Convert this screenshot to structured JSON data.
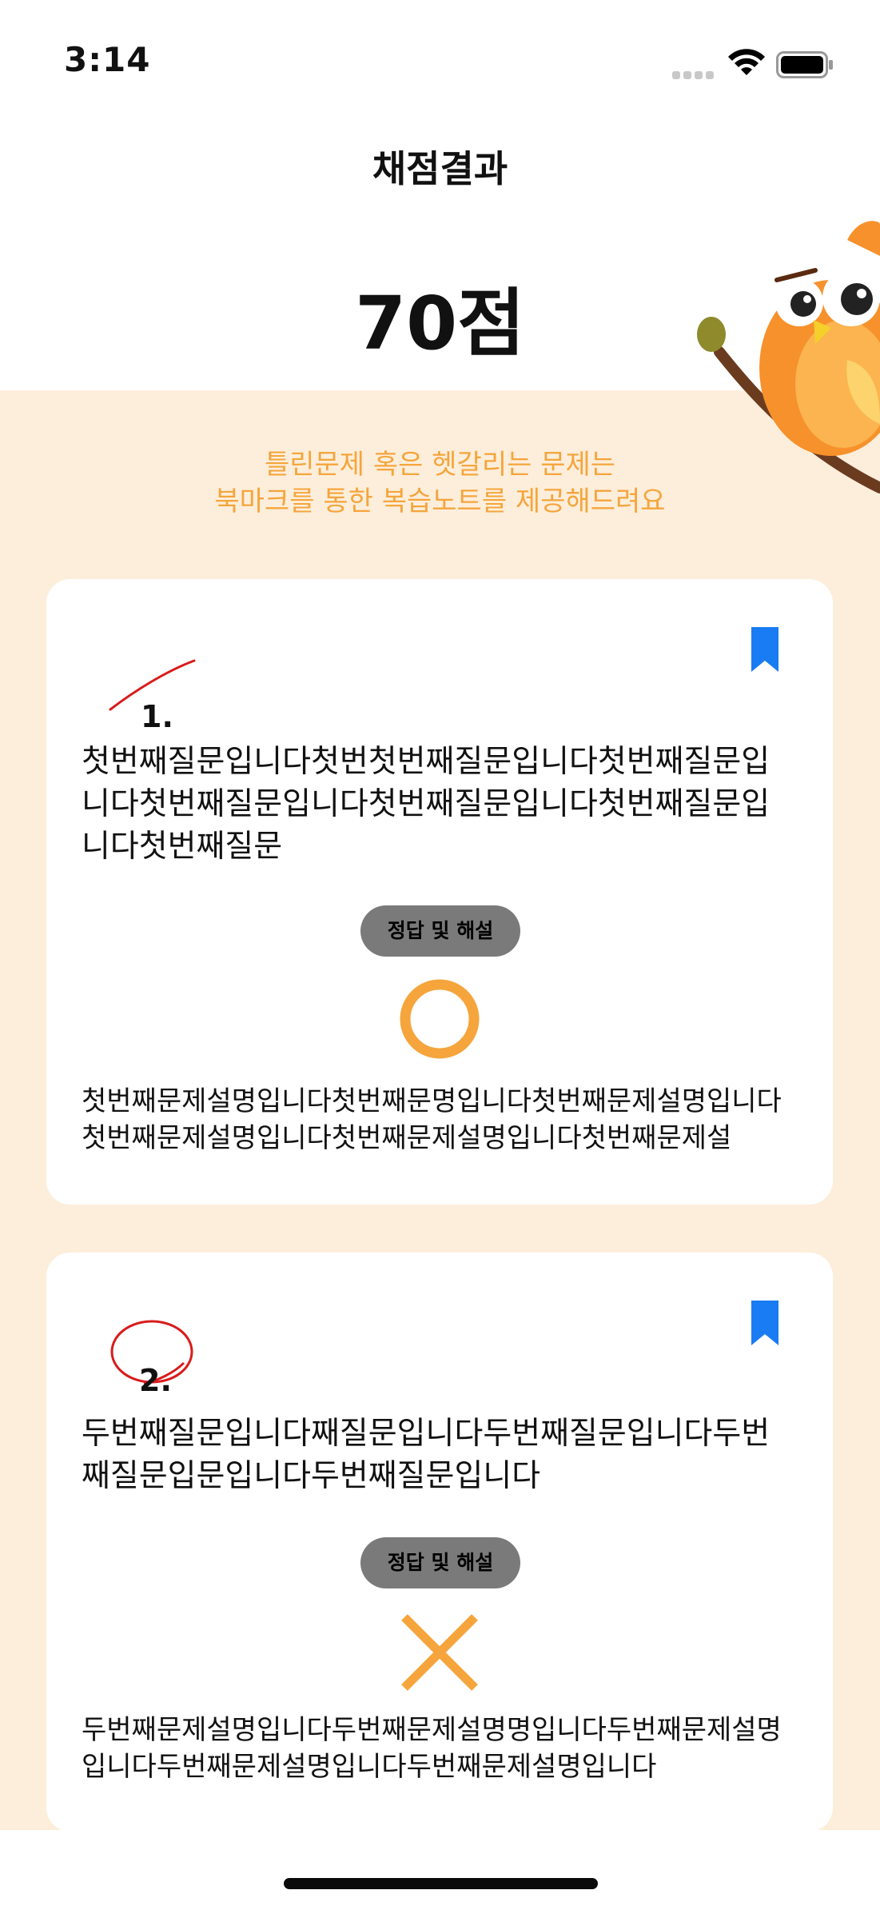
{
  "status_bar": {
    "time": "3:14"
  },
  "header": {
    "title": "채점결과",
    "score": "70점"
  },
  "notice": {
    "line1": "틀린문제 혹은 헷갈리는 문제는",
    "line2": "북마크를 통한 복습노트를 제공해드려요"
  },
  "colors": {
    "accent_orange": "#f5a53c",
    "background_cream": "#fdeedb",
    "bookmark_blue": "#1a7cf2",
    "mark_red": "#d91b1b",
    "button_gray": "#7a7a7a"
  },
  "questions": [
    {
      "number": "1.",
      "number_mark": "slash",
      "question": "첫번째질문입니다첫번첫번째질문입니다첫번째질문입니다첫번째질문입니다첫번째질문입니다첫번째질문입니다첫번째질문",
      "answer_button": "정답 및 해설",
      "result": "correct",
      "result_icon": "circle-icon",
      "explanation": "첫번째문제설명입니다첫번째문명입니다첫번째문제설명입니다첫번째문제설명입니다첫번째문제설명입니다첫번째문제설"
    },
    {
      "number": "2.",
      "number_mark": "circle",
      "question": "두번째질문입니다째질문입니다두번째질문입니다두번째질문입문입니다두번째질문입니다",
      "answer_button": "정답 및 해설",
      "result": "wrong",
      "result_icon": "x-icon",
      "explanation": "두번째문제설명입니다두번째문제설명명입니다두번째문제설명입니다두번째문제설명입니다두번째문제설명입니다"
    }
  ]
}
